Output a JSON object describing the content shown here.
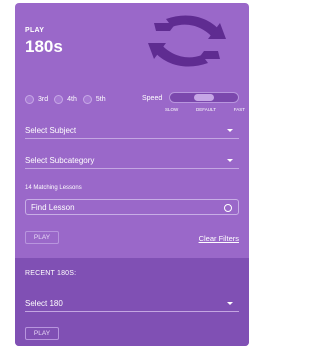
{
  "header": {
    "play_small": "PLAY",
    "play_big": "180s",
    "icon": "refresh-icon"
  },
  "grades": [
    {
      "label": "3rd",
      "checked": false
    },
    {
      "label": "4th",
      "checked": false
    },
    {
      "label": "5th",
      "checked": false
    }
  ],
  "speed": {
    "label": "Speed",
    "stops": [
      "SLOW",
      "DEFAULT",
      "FAST"
    ],
    "selected": "DEFAULT"
  },
  "subject": {
    "placeholder": "Select Subject"
  },
  "subcategory": {
    "placeholder": "Select Subcategory"
  },
  "lessons": {
    "matching_text": "14 Matching Lessons",
    "find_placeholder": "Find Lesson"
  },
  "actions": {
    "play_label": "PLAY",
    "clear_label": "Clear Filters"
  },
  "recent": {
    "title": "RECENT 180S:",
    "select_placeholder": "Select 180",
    "play_label": "PLAY"
  },
  "colors": {
    "panel": "#9a68c9",
    "recent_panel": "#8050b4",
    "icon": "#5f2c91"
  }
}
